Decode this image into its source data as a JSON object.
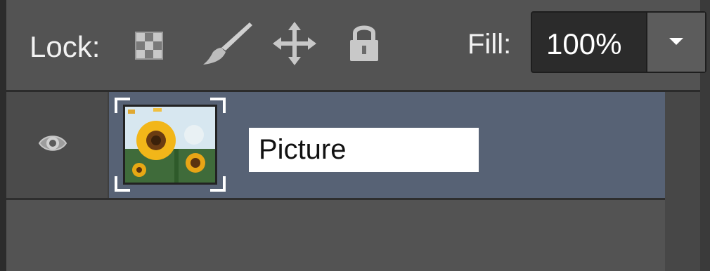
{
  "lock_bar": {
    "label": "Lock:",
    "icons": [
      "lock-transparent-pixels-icon",
      "lock-image-pixels-icon",
      "lock-position-icon",
      "lock-all-icon"
    ]
  },
  "fill": {
    "label": "Fill:",
    "value": "100%"
  },
  "layers": [
    {
      "name": "Picture",
      "visible": true,
      "selected": true,
      "thumbnail": "sunflower-image"
    }
  ],
  "colors": {
    "panel_bg": "#535353",
    "selected_row": "#576275",
    "field_bg": "#2b2b2b",
    "text": "#f2f2f2"
  }
}
